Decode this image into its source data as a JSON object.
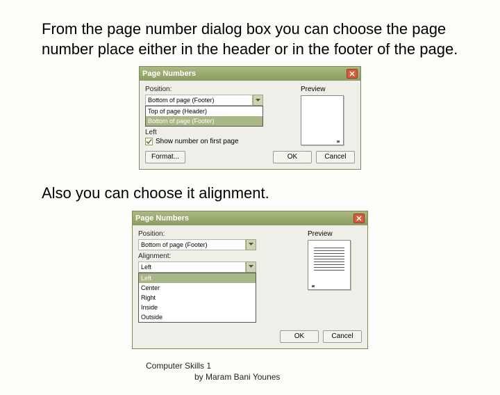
{
  "paragraphs": {
    "p1": "From the page number dialog box you can choose the page number place either in the header or in the footer of the page.",
    "p2": "Also you can choose it alignment."
  },
  "dialog1": {
    "title": "Page Numbers",
    "position_label": "Position:",
    "position_value": "Bottom of page (Footer)",
    "position_options": {
      "opt0": "Top of page (Header)",
      "opt1": "Bottom of page (Footer)"
    },
    "leftover_label": "Left",
    "checkbox_label": "Show number on first page",
    "preview_label": "Preview",
    "buttons": {
      "format": "Format...",
      "ok": "OK",
      "cancel": "Cancel"
    }
  },
  "dialog2": {
    "title": "Page Numbers",
    "position_label": "Position:",
    "position_value": "Bottom of page (Footer)",
    "alignment_label": "Alignment:",
    "alignment_value": "Left",
    "alignment_options": {
      "opt0": "Left",
      "opt1": "Center",
      "opt2": "Right",
      "opt3": "Inside",
      "opt4": "Outside"
    },
    "preview_label": "Preview",
    "buttons": {
      "ok": "OK",
      "cancel": "Cancel"
    }
  },
  "footer": {
    "line1": "Computer Skills 1",
    "line2": "by Maram Bani Younes"
  },
  "colors": {
    "titlebar": "#8a9d5f",
    "close": "#d95b3e",
    "selection": "#a9b786"
  }
}
